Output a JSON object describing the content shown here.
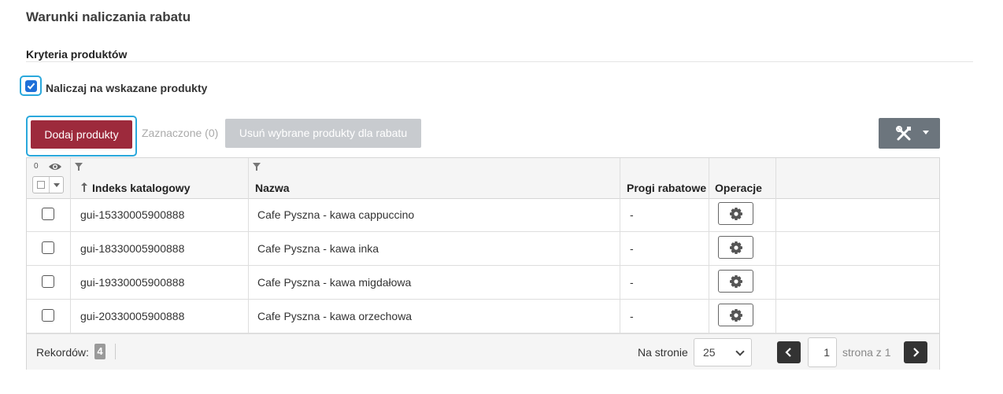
{
  "section": {
    "title": "Warunki naliczania rabatu",
    "subtitle": "Kryteria produktów"
  },
  "checkbox": {
    "label": "Naliczaj na wskazane produkty",
    "checked": true
  },
  "toolbar": {
    "add_label": "Dodaj produkty",
    "marked_label": "Zaznaczone (0)",
    "remove_label": "Usuń wybrane produkty dla rabatu",
    "tools_icon": "tools-icon"
  },
  "grid": {
    "visible_count": "0",
    "columns": {
      "index": "Indeks katalogowy",
      "name": "Nazwa",
      "thresholds": "Progi rabatowe",
      "operations": "Operacje"
    },
    "rows": [
      {
        "index": "gui-15330005900888",
        "name": "Cafe Pyszna - kawa cappuccino",
        "thresholds": "-"
      },
      {
        "index": "gui-18330005900888",
        "name": "Cafe Pyszna - kawa inka",
        "thresholds": "-"
      },
      {
        "index": "gui-19330005900888",
        "name": "Cafe Pyszna - kawa migdałowa",
        "thresholds": "-"
      },
      {
        "index": "gui-20330005900888",
        "name": "Cafe Pyszna - kawa orzechowa",
        "thresholds": "-"
      }
    ]
  },
  "footer": {
    "records_label": "Rekordów:",
    "records_count": "4",
    "per_page_label": "Na stronie",
    "per_page_value": "25",
    "page_value": "1",
    "page_of": "strona z 1"
  },
  "colors": {
    "primary": "#9d2a3c",
    "focus": "#2aa8dc",
    "checkbox": "#1f6fd8",
    "disabled": "#c8cbcf",
    "tools": "#6c757d"
  }
}
